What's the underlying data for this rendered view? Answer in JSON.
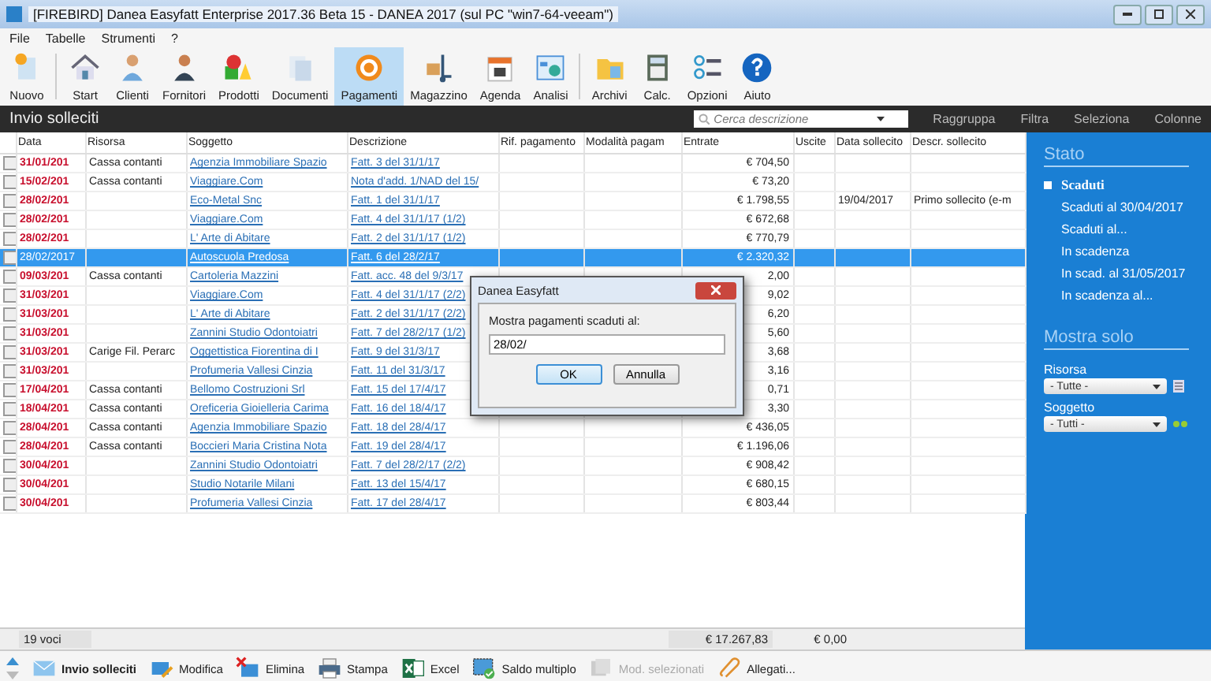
{
  "window": {
    "title": "[FIREBIRD]  Danea Easyfatt Enterprise  2017.36 Beta 15  -  DANEA 2017  (sul PC \"win7-64-veeam\")"
  },
  "menu": [
    "File",
    "Tabelle",
    "Strumenti",
    "?"
  ],
  "toolbar": [
    {
      "label": "Nuovo",
      "selected": false
    },
    {
      "label": "Start",
      "selected": false
    },
    {
      "label": "Clienti",
      "selected": false
    },
    {
      "label": "Fornitori",
      "selected": false
    },
    {
      "label": "Prodotti",
      "selected": false
    },
    {
      "label": "Documenti",
      "selected": false
    },
    {
      "label": "Pagamenti",
      "selected": true
    },
    {
      "label": "Magazzino",
      "selected": false
    },
    {
      "label": "Agenda",
      "selected": false
    },
    {
      "label": "Analisi",
      "selected": false
    },
    {
      "label": "Archivi",
      "selected": false
    },
    {
      "label": "Calc.",
      "selected": false
    },
    {
      "label": "Opzioni",
      "selected": false
    },
    {
      "label": "Aiuto",
      "selected": false
    }
  ],
  "header": {
    "title": "Invio solleciti",
    "search": {
      "placeholder": "Cerca descrizione"
    },
    "actions": [
      "Raggruppa",
      "Filtra",
      "Seleziona",
      "Colonne"
    ]
  },
  "table": {
    "columns": [
      "Data",
      "Risorsa",
      "Soggetto",
      "Descrizione",
      "Rif. pagamento",
      "Modalità pagam",
      "Entrate",
      "Uscite",
      "Data sollecito",
      "Descr. sollecito"
    ],
    "rows": [
      {
        "selected": false,
        "checked": false,
        "overdue": true,
        "data": "31/01/201",
        "risorsa": "Cassa contanti",
        "soggetto": "Agenzia Immobiliare Spazio",
        "descrizione": "Fatt. 3 del 31/1/17",
        "entrate": "€ 704,50"
      },
      {
        "selected": false,
        "checked": false,
        "overdue": true,
        "data": "15/02/201",
        "risorsa": "Cassa contanti",
        "soggetto": "Viaggiare.Com",
        "descrizione": "Nota d'add. 1/NAD del 15/",
        "entrate": "€ 73,20"
      },
      {
        "selected": false,
        "checked": false,
        "overdue": true,
        "data": "28/02/201",
        "soggetto": "Eco-Metal Snc",
        "descrizione": "Fatt. 1 del 31/1/17",
        "entrate": "€ 1.798,55",
        "data_sollecito": "19/04/2017",
        "descr_sollecito": "Primo sollecito (e-m"
      },
      {
        "selected": false,
        "checked": false,
        "overdue": true,
        "data": "28/02/201",
        "soggetto": "Viaggiare.Com",
        "descrizione": "Fatt. 4 del 31/1/17  (1/2)",
        "entrate": "€ 672,68"
      },
      {
        "selected": false,
        "checked": false,
        "overdue": true,
        "data": "28/02/201",
        "soggetto": "L' Arte di Abitare",
        "descrizione": "Fatt. 2 del 31/1/17  (1/2)",
        "entrate": "€ 770,79"
      },
      {
        "selected": true,
        "checked": false,
        "overdue": true,
        "data": "28/02/2017",
        "soggetto": "Autoscuola Predosa",
        "descrizione": "Fatt. 6 del 28/2/17",
        "entrate": "€ 2.320,32"
      },
      {
        "selected": false,
        "checked": false,
        "overdue": true,
        "data": "09/03/201",
        "risorsa": "Cassa contanti",
        "soggetto": "Cartoleria Mazzini",
        "descrizione": "Fatt. acc. 48 del 9/3/17",
        "entrate": "2,00"
      },
      {
        "selected": false,
        "checked": false,
        "overdue": true,
        "data": "31/03/201",
        "soggetto": "Viaggiare.Com",
        "descrizione": "Fatt. 4 del 31/1/17  (2/2)",
        "entrate": "9,02"
      },
      {
        "selected": false,
        "checked": false,
        "overdue": true,
        "data": "31/03/201",
        "soggetto": "L' Arte di Abitare",
        "descrizione": "Fatt. 2 del 31/1/17  (2/2)",
        "entrate": "6,20"
      },
      {
        "selected": false,
        "checked": false,
        "overdue": true,
        "data": "31/03/201",
        "soggetto": "Zannini Studio Odontoiatri",
        "descrizione": "Fatt. 7 del 28/2/17  (1/2)",
        "entrate": "5,60"
      },
      {
        "selected": false,
        "checked": false,
        "overdue": true,
        "data": "31/03/201",
        "risorsa": "Carige Fil. Perarc",
        "soggetto": "Oggettistica Fiorentina di I",
        "descrizione": "Fatt. 9 del 31/3/17",
        "entrate": "3,68"
      },
      {
        "selected": false,
        "checked": false,
        "overdue": true,
        "data": "31/03/201",
        "soggetto": "Profumeria Vallesi Cinzia",
        "descrizione": "Fatt. 11 del 31/3/17",
        "entrate": "3,16"
      },
      {
        "selected": false,
        "checked": false,
        "overdue": true,
        "data": "17/04/201",
        "risorsa": "Cassa contanti",
        "soggetto": "Bellomo Costruzioni Srl",
        "descrizione": "Fatt. 15 del 17/4/17",
        "entrate": "0,71"
      },
      {
        "selected": false,
        "checked": false,
        "overdue": true,
        "data": "18/04/201",
        "risorsa": "Cassa contanti",
        "soggetto": "Oreficeria Gioielleria Carima",
        "descrizione": "Fatt. 16 del 18/4/17",
        "entrate": "3,30"
      },
      {
        "selected": false,
        "checked": false,
        "overdue": true,
        "data": "28/04/201",
        "risorsa": "Cassa contanti",
        "soggetto": "Agenzia Immobiliare Spazio",
        "descrizione": "Fatt. 18 del 28/4/17",
        "entrate": "€ 436,05"
      },
      {
        "selected": false,
        "checked": false,
        "overdue": true,
        "data": "28/04/201",
        "risorsa": "Cassa contanti",
        "soggetto": "Boccieri Maria Cristina Nota",
        "descrizione": "Fatt. 19 del 28/4/17",
        "entrate": "€ 1.196,06"
      },
      {
        "selected": false,
        "checked": false,
        "overdue": true,
        "data": "30/04/201",
        "soggetto": "Zannini Studio Odontoiatri",
        "descrizione": "Fatt. 7 del 28/2/17  (2/2)",
        "entrate": "€ 908,42"
      },
      {
        "selected": false,
        "checked": false,
        "overdue": true,
        "data": "30/04/201",
        "soggetto": "Studio Notarile Milani",
        "descrizione": "Fatt. 13 del 15/4/17",
        "entrate": "€ 680,15"
      },
      {
        "selected": false,
        "checked": false,
        "overdue": true,
        "data": "30/04/201",
        "soggetto": "Profumeria Vallesi Cinzia",
        "descrizione": "Fatt. 17 del 28/4/17",
        "entrate": "€ 803,44"
      }
    ]
  },
  "status_bar": {
    "count": "19 voci",
    "total_entrate": "€ 17.267,83",
    "total_uscite": "€ 0,00"
  },
  "sidebar": {
    "stato_title": "Stato",
    "stato_items": [
      {
        "label": "Scaduti",
        "selected": true
      },
      {
        "label": "Scaduti al 30/04/2017",
        "selected": false
      },
      {
        "label": "Scaduti al...",
        "selected": false
      },
      {
        "label": "In scadenza",
        "selected": false
      },
      {
        "label": "In scad. al 31/05/2017",
        "selected": false
      },
      {
        "label": "In scadenza al...",
        "selected": false
      }
    ],
    "mostra_title": "Mostra solo",
    "filters": [
      {
        "label": "Risorsa",
        "value": "- Tutte -"
      },
      {
        "label": "Soggetto",
        "value": "- Tutti -"
      }
    ]
  },
  "dialog": {
    "title": "Danea Easyfatt",
    "prompt": "Mostra pagamenti scaduti al:",
    "value": "28/02/",
    "buttons": [
      "OK",
      "Annulla"
    ]
  },
  "bottom_toolbar": [
    {
      "label": "Invio solleciti",
      "disabled": false
    },
    {
      "label": "Modifica",
      "disabled": false
    },
    {
      "label": "Elimina",
      "disabled": false
    },
    {
      "label": "Stampa",
      "disabled": false
    },
    {
      "label": "Excel",
      "disabled": false
    },
    {
      "label": "Saldo multiplo",
      "disabled": false
    },
    {
      "label": "Mod. selezionati",
      "disabled": true
    },
    {
      "label": "Allegati...",
      "disabled": false
    }
  ]
}
